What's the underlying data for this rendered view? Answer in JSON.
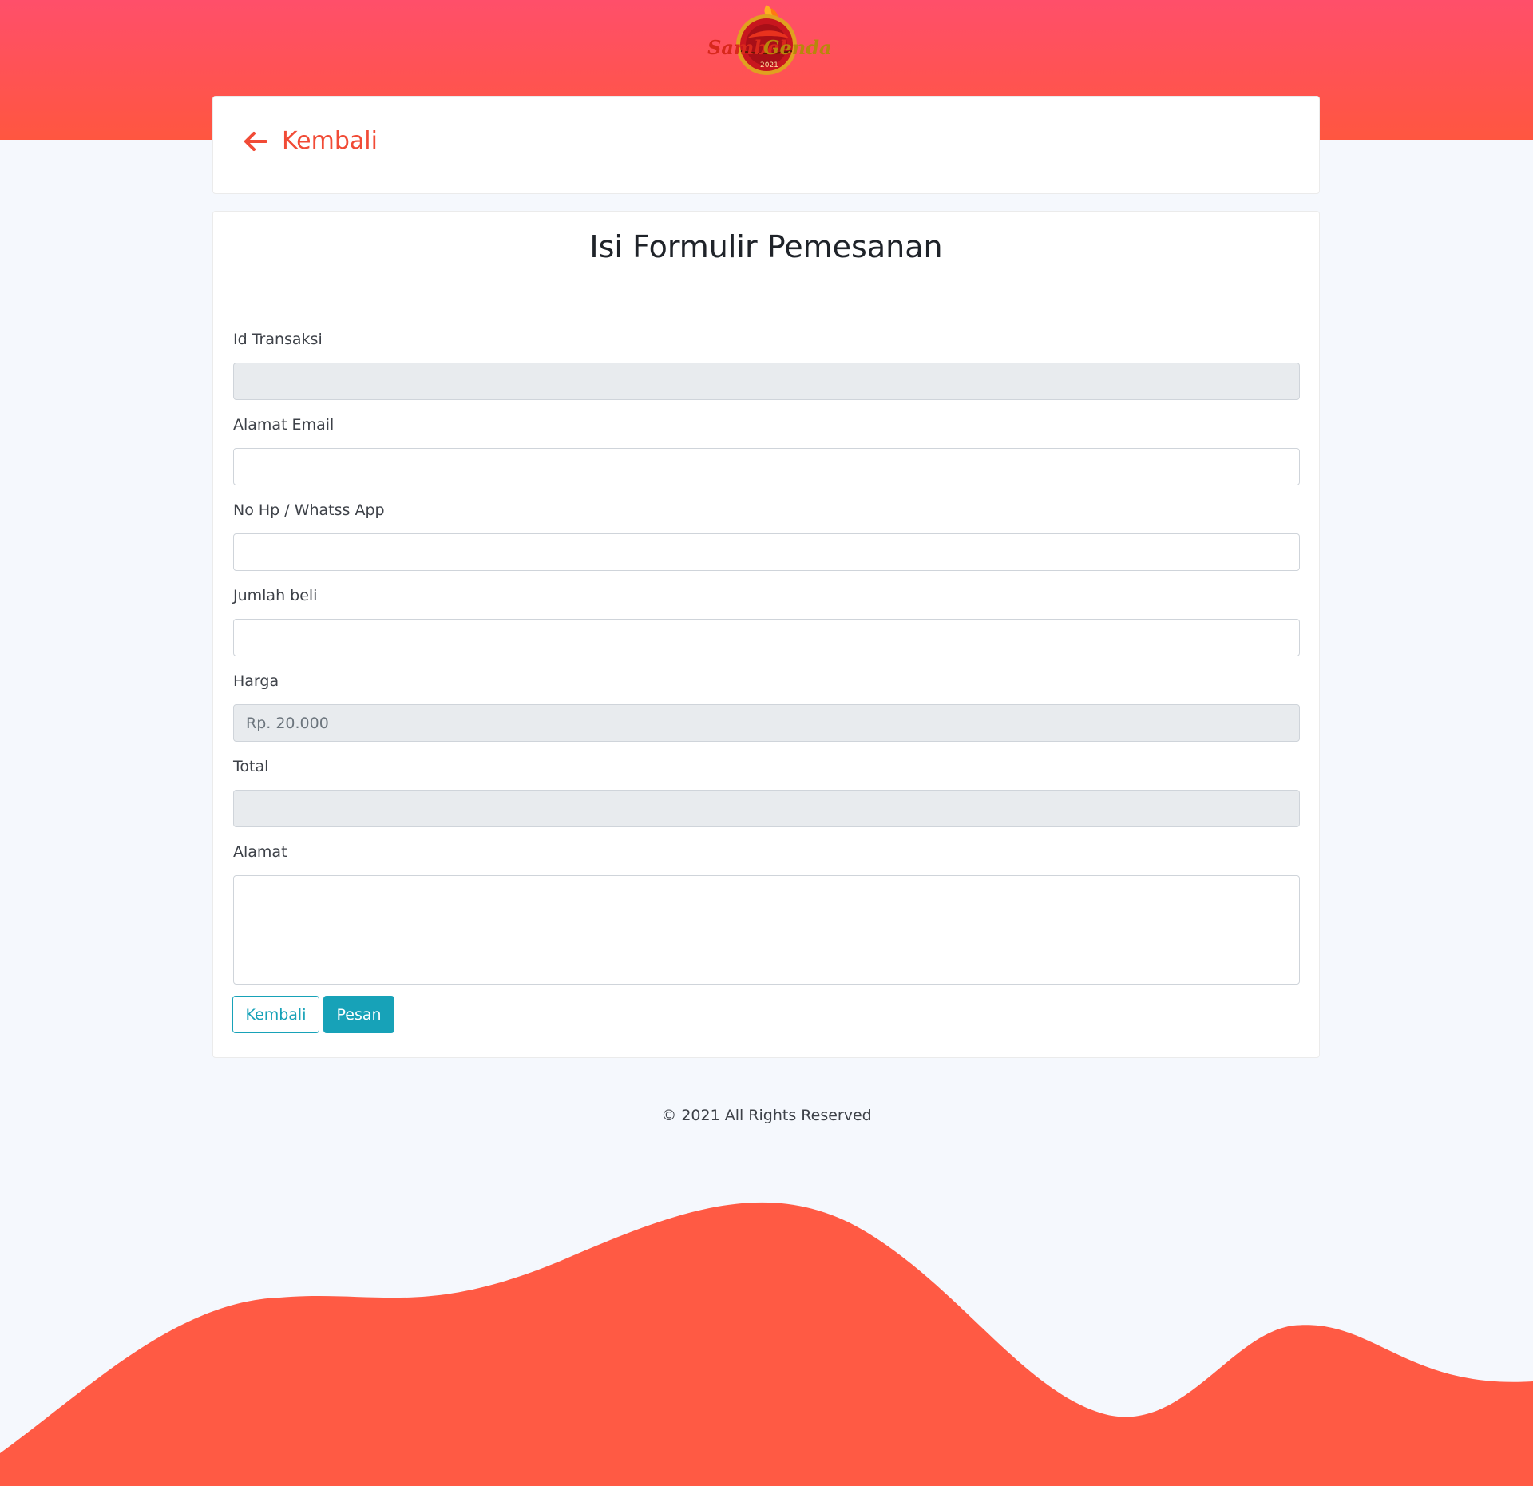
{
  "brand": {
    "logo_icon": "chili-fire-logo",
    "logo_text": "SambelGendang",
    "accent_color": "#ff5640",
    "top_gradient": [
      "#ff4f6a",
      "#ff5640"
    ],
    "button_color": "#17a2b8"
  },
  "back_card": {
    "icon": "arrow-left-icon",
    "label": "Kembali"
  },
  "form": {
    "title": "Isi Formulir Pemesanan",
    "fields": [
      {
        "label": "Id Transaksi",
        "value": "",
        "placeholder": "",
        "readonly": true
      },
      {
        "label": "Alamat Email",
        "value": "",
        "placeholder": "",
        "readonly": false
      },
      {
        "label": "No Hp / Whatss App",
        "value": "",
        "placeholder": "",
        "readonly": false
      },
      {
        "label": "Jumlah beli",
        "value": "",
        "placeholder": "",
        "readonly": false
      },
      {
        "label": "Harga",
        "value": "",
        "placeholder": "Rp. 20.000",
        "readonly": true
      },
      {
        "label": "Total",
        "value": "",
        "placeholder": "",
        "readonly": true
      },
      {
        "label": "Alamat",
        "value": "",
        "placeholder": "",
        "readonly": false
      }
    ],
    "buttons": {
      "back_label": "Kembali",
      "submit_label": "Pesan"
    }
  },
  "footer": {
    "copyright": "© 2021 All Rights Reserved"
  }
}
